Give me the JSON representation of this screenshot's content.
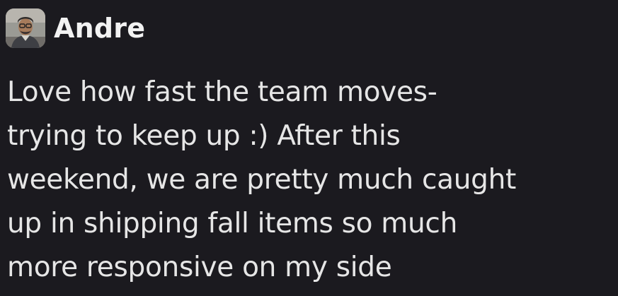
{
  "message": {
    "author": "Andre",
    "avatar_icon": "user-avatar-photo",
    "lines": [
      "Love how fast the team moves-",
      "trying to keep up :) After this",
      "weekend, we are pretty much caught",
      "up in shipping fall items so much",
      "more responsive on my side"
    ]
  },
  "colors": {
    "background": "#1b1a1f",
    "text": "#e6e6e6",
    "author": "#f2f2f2"
  }
}
